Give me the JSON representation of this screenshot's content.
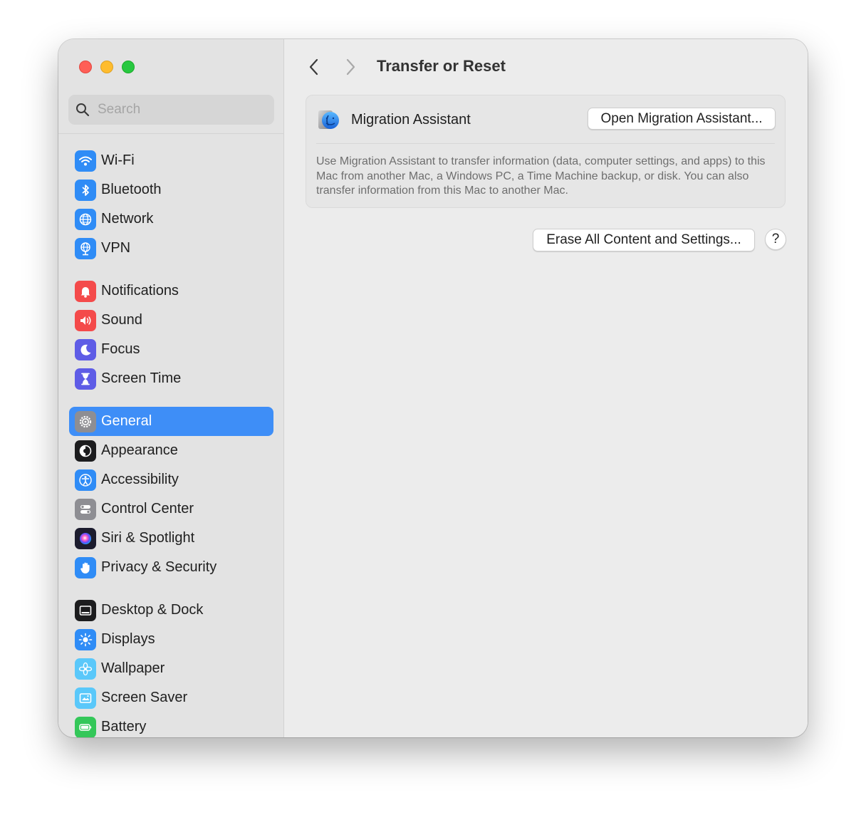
{
  "search": {
    "placeholder": "Search"
  },
  "sidebar": {
    "groups": [
      [
        {
          "label": "Wi-Fi",
          "icon": "wifi-icon",
          "color": "#2f8cf6"
        },
        {
          "label": "Bluetooth",
          "icon": "bluetooth-icon",
          "color": "#2f8cf6"
        },
        {
          "label": "Network",
          "icon": "globe-icon",
          "color": "#2f8cf6"
        },
        {
          "label": "VPN",
          "icon": "vpn-globe-icon",
          "color": "#2f8cf6"
        }
      ],
      [
        {
          "label": "Notifications",
          "icon": "bell-icon",
          "color": "#f44a4a"
        },
        {
          "label": "Sound",
          "icon": "speaker-icon",
          "color": "#f44a4a"
        },
        {
          "label": "Focus",
          "icon": "moon-icon",
          "color": "#5e5ce6"
        },
        {
          "label": "Screen Time",
          "icon": "hourglass-icon",
          "color": "#5e5ce6"
        }
      ],
      [
        {
          "label": "General",
          "icon": "gear-icon",
          "color": "#8e8e93",
          "selected": true
        },
        {
          "label": "Appearance",
          "icon": "appearance-icon",
          "color": "#1c1c1e"
        },
        {
          "label": "Accessibility",
          "icon": "accessibility-icon",
          "color": "#2f8cf6"
        },
        {
          "label": "Control Center",
          "icon": "toggles-icon",
          "color": "#8e8e93"
        },
        {
          "label": "Siri & Spotlight",
          "icon": "siri-icon",
          "color": "#1c1c2e"
        },
        {
          "label": "Privacy & Security",
          "icon": "hand-icon",
          "color": "#2f8cf6"
        }
      ],
      [
        {
          "label": "Desktop & Dock",
          "icon": "dock-icon",
          "color": "#1c1c1e"
        },
        {
          "label": "Displays",
          "icon": "sun-icon",
          "color": "#2f8cf6"
        },
        {
          "label": "Wallpaper",
          "icon": "flower-icon",
          "color": "#5ac8fa"
        },
        {
          "label": "Screen Saver",
          "icon": "screensaver-icon",
          "color": "#5ac8fa"
        },
        {
          "label": "Battery",
          "icon": "battery-icon",
          "color": "#34c759"
        }
      ]
    ]
  },
  "header": {
    "title": "Transfer or Reset"
  },
  "migration": {
    "name": "Migration Assistant",
    "button": "Open Migration Assistant...",
    "description": "Use Migration Assistant to transfer information (data, computer settings, and apps) to this Mac from another Mac, a Windows PC, a Time Machine backup, or disk. You can also transfer information from this Mac to another Mac."
  },
  "erase": {
    "button": "Erase All Content and Settings..."
  },
  "help": {
    "label": "?"
  }
}
